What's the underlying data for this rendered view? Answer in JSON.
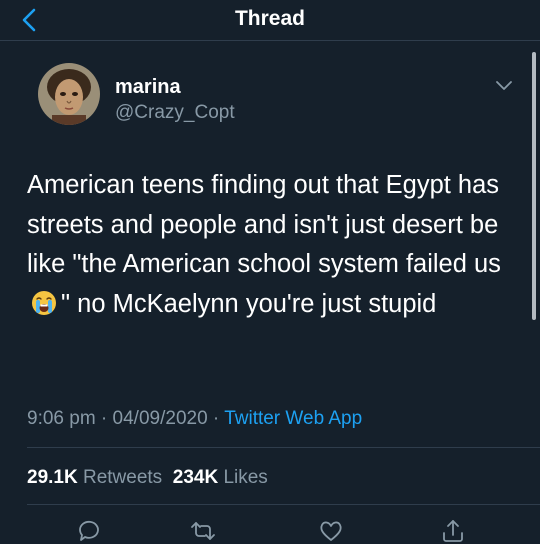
{
  "header": {
    "title": "Thread",
    "back_icon": "chevron-left-icon"
  },
  "tweet": {
    "author_name": "marina",
    "author_handle": "@Crazy_Copt",
    "text_before_emoji": "American teens finding out that Egypt has streets and people and isn't just desert be like \"the American school system failed us",
    "emoji": "loudly-crying-face-emoji",
    "text_after_emoji": "\" no McKaelynn you're just stupid",
    "time": "9:06 pm",
    "date": "04/09/2020",
    "source_app": "Twitter Web App",
    "retweets_count": "29.1K",
    "retweets_label": "Retweets",
    "likes_count": "234K",
    "likes_label": "Likes"
  },
  "actions": [
    "reply-icon",
    "retweet-icon",
    "like-icon",
    "share-icon"
  ],
  "colors": {
    "background": "#15202b",
    "secondary_text": "#8899a6",
    "link": "#1da1f2",
    "divider": "#2f3d4c"
  }
}
